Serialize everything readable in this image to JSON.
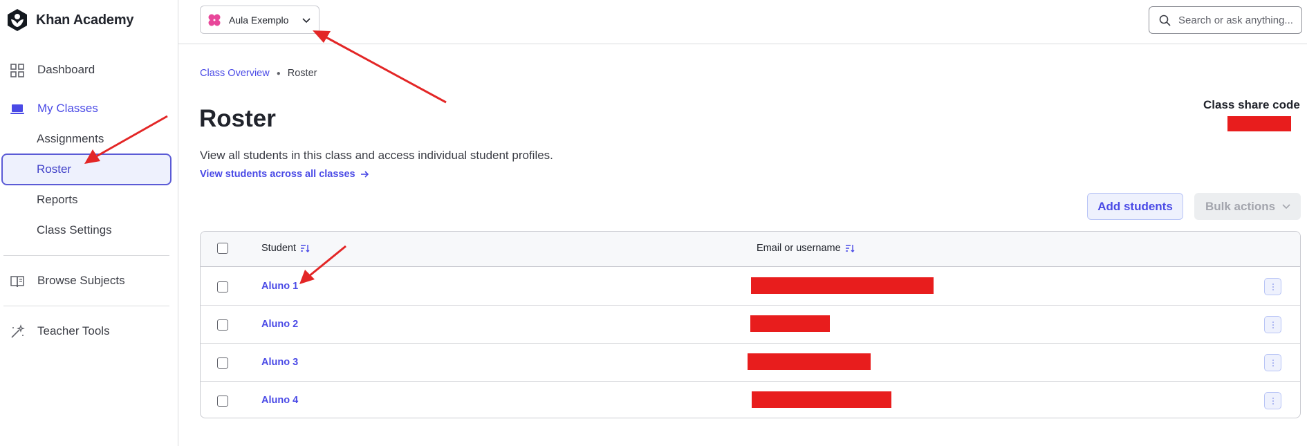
{
  "app": {
    "logo_text": "Khan Academy"
  },
  "sidebar": {
    "nav": [
      {
        "label": "Dashboard",
        "icon": "grid-icon"
      },
      {
        "label": "My Classes",
        "icon": "laptop-icon"
      }
    ],
    "sub_items": [
      {
        "label": "Assignments"
      },
      {
        "label": "Roster"
      },
      {
        "label": "Reports"
      },
      {
        "label": "Class Settings"
      }
    ],
    "browse_subjects": "Browse Subjects",
    "teacher_tools": "Teacher Tools"
  },
  "topbar": {
    "class_name": "Aula Exemplo",
    "search_placeholder": "Search or ask anything..."
  },
  "breadcrumb": {
    "parent": "Class Overview",
    "current": "Roster"
  },
  "page": {
    "title": "Roster",
    "description": "View all students in this class and access individual student profiles.",
    "view_link": "View students across all classes",
    "share_code_label": "Class share code"
  },
  "actions": {
    "add_students": "Add students",
    "bulk_actions": "Bulk actions"
  },
  "table": {
    "col_student": "Student",
    "col_email": "Email or username",
    "rows": [
      {
        "name": "Aluno 1"
      },
      {
        "name": "Aluno 2"
      },
      {
        "name": "Aluno 3"
      },
      {
        "name": "Aluno 4"
      }
    ]
  },
  "colors": {
    "accent": "#4a4ae6",
    "redaction": "#e81d1d",
    "annotation_arrow": "#e32626"
  }
}
